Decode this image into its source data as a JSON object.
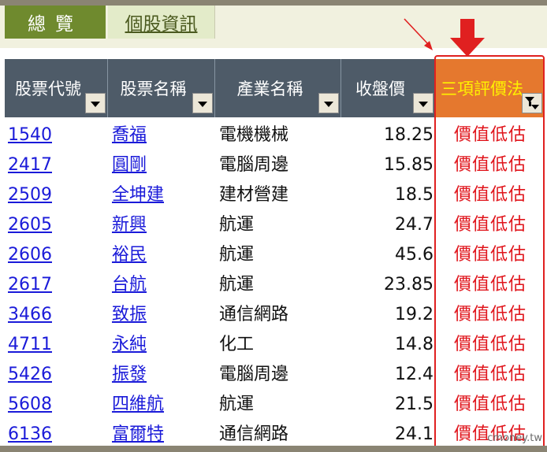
{
  "tabs": [
    {
      "label": "總覽",
      "active": true
    },
    {
      "label": "個股資訊",
      "active": false
    }
  ],
  "columns": [
    {
      "label": "股票代號"
    },
    {
      "label": "股票名稱"
    },
    {
      "label": "產業名稱"
    },
    {
      "label": "收盤價"
    },
    {
      "label": "三項評價法",
      "filtered": true
    }
  ],
  "rows": [
    {
      "code": "1540",
      "name": "喬福",
      "industry": "電機機械",
      "price": "18.25",
      "eval": "價值低估"
    },
    {
      "code": "2417",
      "name": "圓剛",
      "industry": "電腦周邊",
      "price": "15.85",
      "eval": "價值低估"
    },
    {
      "code": "2509",
      "name": "全坤建",
      "industry": "建材營建",
      "price": "18.5",
      "eval": "價值低估"
    },
    {
      "code": "2605",
      "name": "新興",
      "industry": "航運",
      "price": "24.7",
      "eval": "價值低估"
    },
    {
      "code": "2606",
      "name": "裕民",
      "industry": "航運",
      "price": "45.6",
      "eval": "價值低估"
    },
    {
      "code": "2617",
      "name": "台航",
      "industry": "航運",
      "price": "23.85",
      "eval": "價值低估"
    },
    {
      "code": "3466",
      "name": "致振",
      "industry": "通信網路",
      "price": "19.2",
      "eval": "價值低估"
    },
    {
      "code": "4711",
      "name": "永純",
      "industry": "化工",
      "price": "14.8",
      "eval": "價值低估"
    },
    {
      "code": "5426",
      "name": "振發",
      "industry": "電腦周邊",
      "price": "12.4",
      "eval": "價值低估"
    },
    {
      "code": "5608",
      "name": "四維航",
      "industry": "航運",
      "price": "21.5",
      "eval": "價值低估"
    },
    {
      "code": "6136",
      "name": "富爾特",
      "industry": "通信網路",
      "price": "24.1",
      "eval": "價值低估"
    }
  ],
  "watermark": "cmoney.tw",
  "colors": {
    "header_bg": "#4e5b68",
    "eval_header_bg": "#e5782e",
    "eval_header_text": "#fff200",
    "link": "#1a1ad9",
    "eval_text": "#e0141b",
    "highlight": "#e02020"
  }
}
